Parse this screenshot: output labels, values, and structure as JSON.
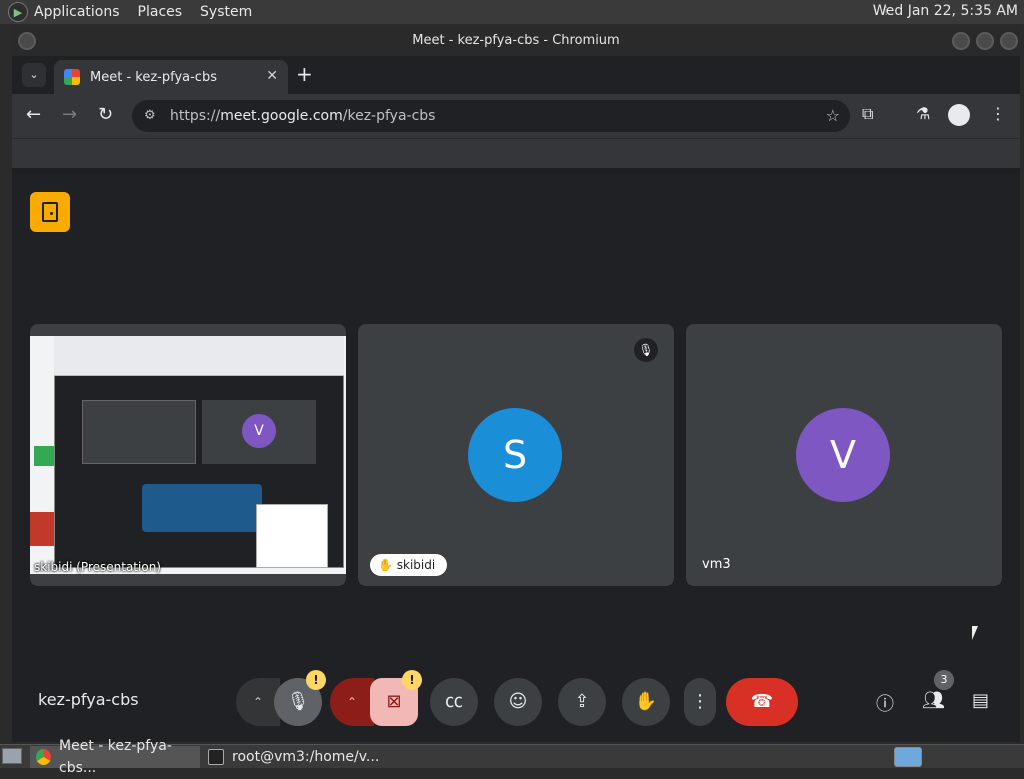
{
  "desktop": {
    "menus": [
      "Applications",
      "Places",
      "System"
    ],
    "clock": "Wed Jan 22,  5:35 AM"
  },
  "window": {
    "title": "Meet - kez-pfya-cbs - Chromium"
  },
  "browser": {
    "tab_title": "Meet - kez-pfya-cbs",
    "tab_close": "✕",
    "new_tab": "+",
    "url_scheme": "https://",
    "url_host": "meet.google.com",
    "url_path": "/kez-pfya-cbs"
  },
  "meet": {
    "tiles": [
      {
        "caption": "skibidi (Presentation)"
      },
      {
        "initial": "S",
        "name": "skibidi",
        "color": "#1a8fd8"
      },
      {
        "initial": "V",
        "name": "vm3",
        "color": "#7e57c2"
      }
    ],
    "meeting_code": "kez-pfya-cbs",
    "warning_symbol": "!",
    "people_count": "3"
  },
  "taskbar": {
    "items": [
      "Meet - kez-pfya-cbs...",
      "root@vm3:/home/v..."
    ]
  },
  "colors": {
    "end_call": "#d93025",
    "warning": "#fdd663",
    "room_icon": "#f9ab00"
  }
}
